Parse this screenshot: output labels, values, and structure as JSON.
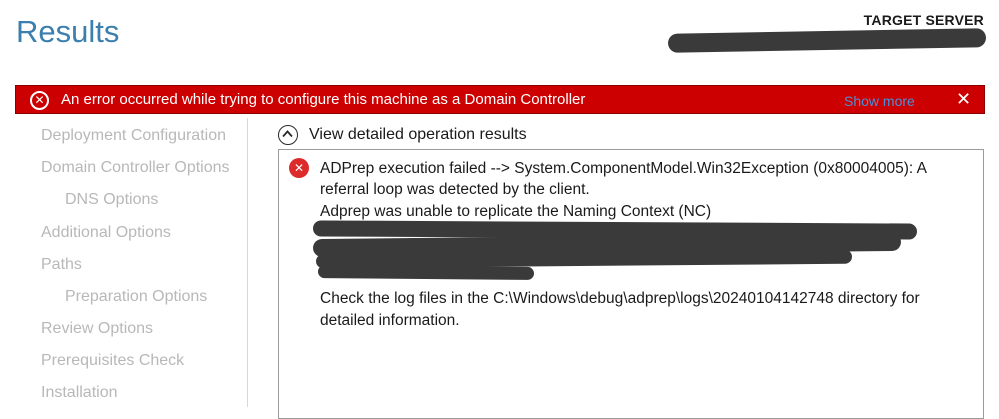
{
  "header": {
    "title": "Results",
    "target_label": "TARGET SERVER"
  },
  "error_bar": {
    "message": "An error occurred while trying to configure this machine as a Domain Controller",
    "show_more": "Show more",
    "close": "✕",
    "icon_glyph": "✕"
  },
  "sidebar": {
    "items": [
      {
        "label": "Deployment Configuration"
      },
      {
        "label": "Domain Controller Options"
      },
      {
        "label": "DNS Options"
      },
      {
        "label": "Additional Options"
      },
      {
        "label": "Paths"
      },
      {
        "label": "Preparation Options"
      },
      {
        "label": "Review Options"
      },
      {
        "label": "Prerequisites Check"
      },
      {
        "label": "Installation"
      }
    ]
  },
  "results": {
    "toggle_label": "View detailed operation results",
    "icon_glyph": "✕",
    "lines": [
      "ADPrep execution failed --> System.ComponentModel.Win32Exception (0x80004005): A",
      "referral loop was detected by the client.",
      "Adprep was unable to replicate the Naming Context (NC)"
    ],
    "footer_lines": [
      "Check the log files in the C:\\Windows\\debug\\adprep\\logs\\20240104142748 directory for",
      "detailed information."
    ]
  },
  "colors": {
    "error_red": "#cc0000",
    "title_blue": "#3b7fae",
    "link_blue": "#4a90d9",
    "nav_gray": "#b8b8b8"
  }
}
